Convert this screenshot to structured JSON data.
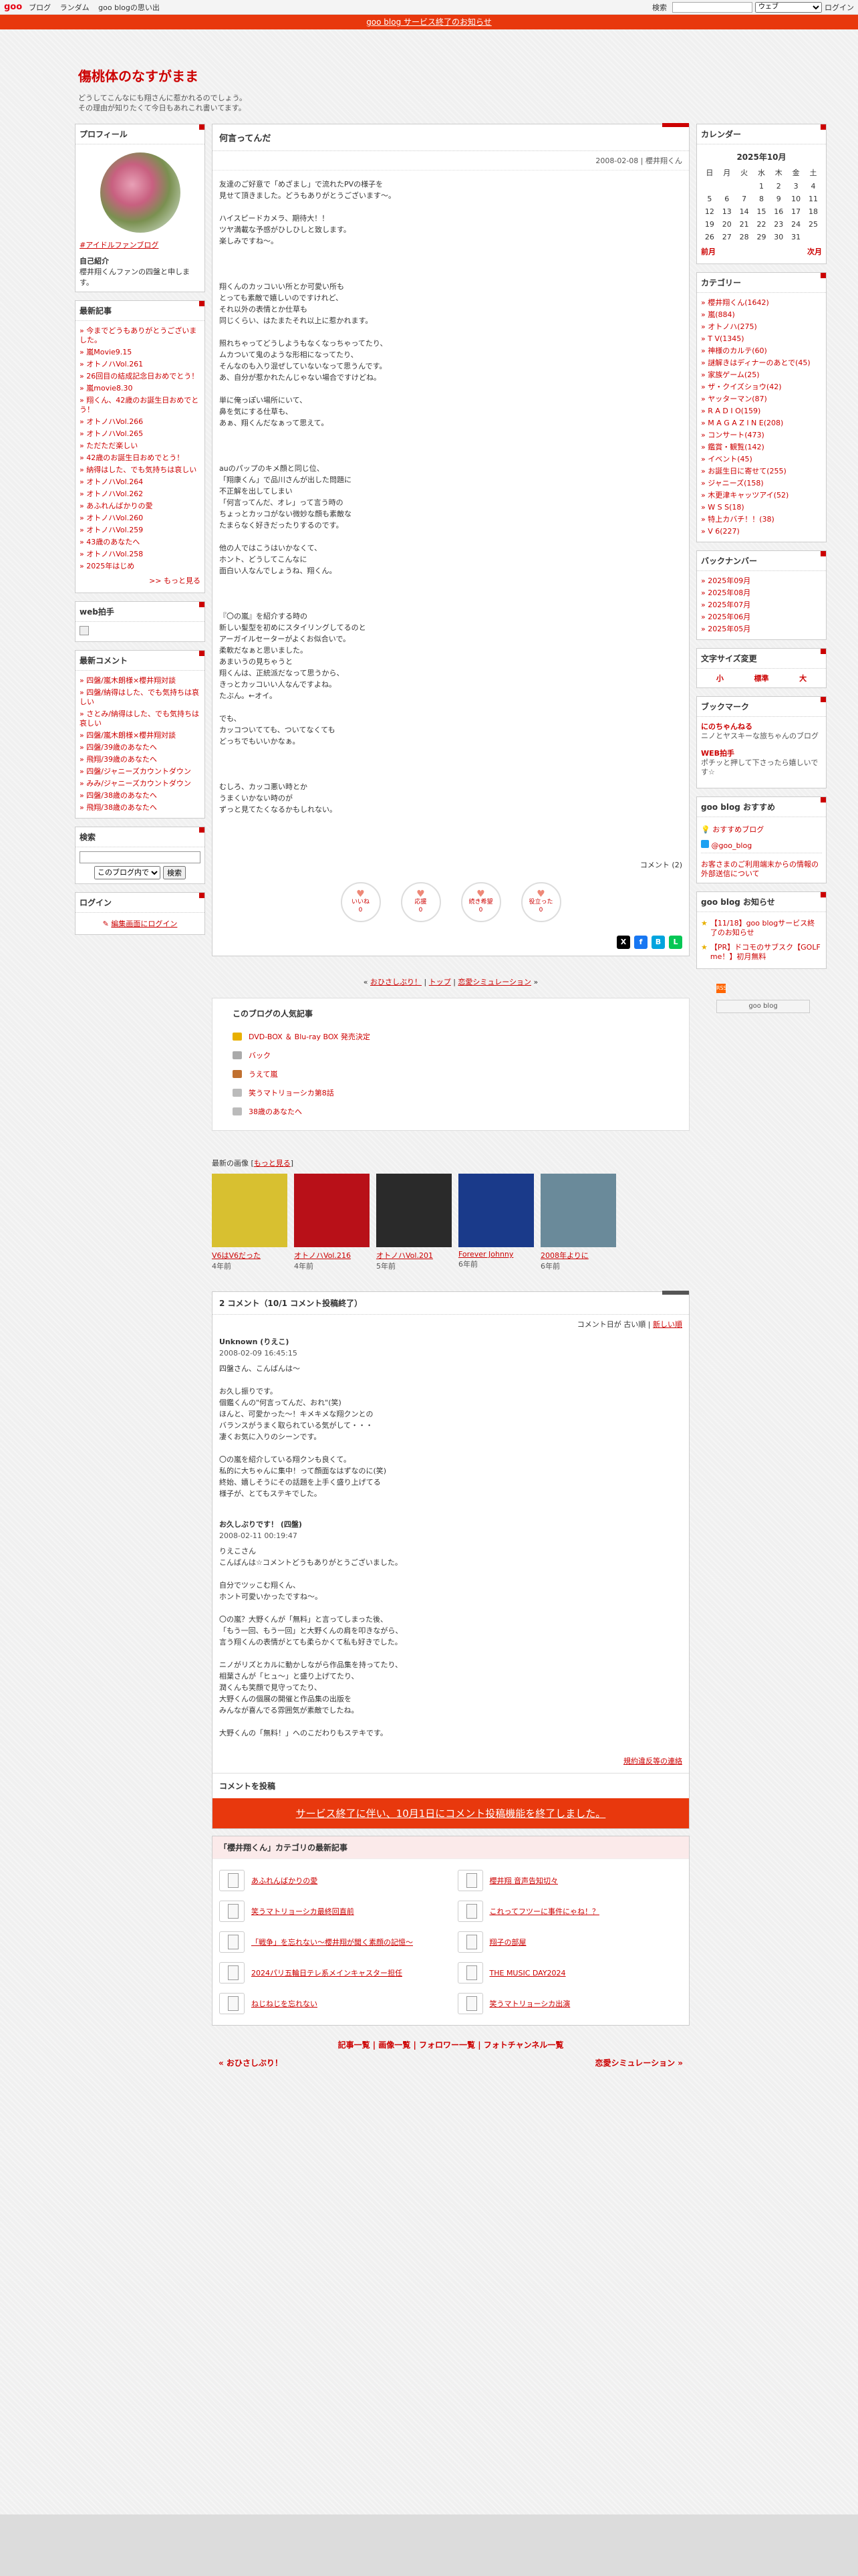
{
  "topbar": {
    "logo": "goo",
    "nav": [
      "ブログ",
      "ランダム",
      "goo blogの思い出"
    ],
    "search_label": "検索",
    "search_scope": "ウェブ",
    "login": "ログイン"
  },
  "notice": "goo blog サービス終了のお知らせ",
  "header": {
    "title": "傷桃体のなすがまま",
    "desc1": "どうしてこんなにも翔さんに惹かれるのでしょう。",
    "desc2": "その理由が知りたくて今日もあれこれ書いてます。"
  },
  "left": {
    "profile": {
      "heading": "プロフィール",
      "link": "#アイドルファンブログ",
      "intro_label": "自己紹介",
      "intro": "櫻井翔くんファンの四盤と申します。"
    },
    "recent": {
      "heading": "最新記事",
      "items": [
        "今までどうもありがとうございました。",
        "嵐Movie9.15",
        "オトノハVol.261",
        "26回目の結成記念日おめでとう！",
        "嵐movie8.30",
        "翔くん、42歳のお誕生日おめでとう！",
        "オトノハVol.266",
        "オトノハVol.265",
        "ただただ楽しい",
        "42歳のお誕生日おめでとう！",
        "納得はした、でも気持ちは哀しい",
        "オトノハVol.264",
        "オトノハVol.262",
        "あふれんばかりの愛",
        "オトノハVol.260",
        "オトノハVol.259",
        "43歳のあなたへ",
        "オトノハVol.258",
        "2025年はじめ"
      ],
      "more": ">> もっと見る"
    },
    "webclap": {
      "heading": "web拍手"
    },
    "comments": {
      "heading": "最新コメント",
      "items": [
        "四盤/嵐木朗様×櫻井翔対談",
        "四盤/納得はした、でも気持ちは哀しい",
        "さとみ/納得はした、でも気持ちは哀しい",
        "四盤/嵐木朗様×櫻井翔対談",
        "四盤/39歳のあなたへ",
        "飛翔/39歳のあなたへ",
        "四盤/ジャニーズカウントダウン",
        "みみ/ジャニーズカウントダウン",
        "四盤/38歳のあなたへ",
        "飛翔/38歳のあなたへ"
      ]
    },
    "search": {
      "heading": "検索",
      "scope": "このブログ内で",
      "button": "検索"
    },
    "login": {
      "heading": "ログイン",
      "link": "編集画面にログイン"
    }
  },
  "article": {
    "title": "何言ってんだ",
    "meta": "2008-02-08 | 櫻井翔くん",
    "paragraphs": [
      [
        "友達のご好意で「めざまし」で流れたPVの様子を",
        "見せて頂きました。どうもありがとうございます～。"
      ],
      [
        "ハイスピードカメラ、期待大！！",
        "ツヤ満載な予感がひしひしと致します。",
        "楽しみですね～。"
      ],
      [],
      [
        "翔くんのカッコいい所とか可愛い所も",
        "とっても素敵で嬉しいのですけれど、",
        "それ以外の表情とか仕草も",
        "同じくらい、はたまたそれ以上に惹かれます。"
      ],
      [
        "照れちゃってどうしようもなくなっちゃってたり、",
        "ムカついて鬼のような形相になってたり、",
        "そんなのも入り混ぜしていないなって思うんです。",
        "あ、自分が惹かれたんじゃない場合ですけどね。"
      ],
      [
        "単に俺っぽい場所にいて、",
        "鼻を気にする仕草も、",
        "あぁ、翔くんだなぁって思えて。"
      ],
      [],
      [
        "auのパップのキメ顔と同じ位、",
        "「翔康くん」で品川さんが出した問題に",
        "不正解を出してしまい",
        "「何言ってんだ、オレ」って言う時の",
        "ちょっとカッコがない微妙な顔も素敵な",
        "たまらなく好きだったりするのです。"
      ],
      [
        "他の人ではこうはいかなくて、",
        "ホント、どうしてこんなに",
        "面白い人なんでしょうね、翔くん。"
      ],
      [],
      [
        "『〇の嵐』を紹介する時の",
        "新しい髪型を初めにスタイリングしてるのと",
        "アーガイルセーターがよくお似合いで。",
        "柔軟だなぁと思いました。",
        "あまいうの見ちゃうと",
        "翔くんは、正統派だなって思うから、",
        "きっとカッコいい人なんですよね。",
        "たぶん。←オイ。"
      ],
      [
        "でも、",
        "カッコついてても、ついてなくても",
        "どっちでもいいかなぁ。"
      ],
      [],
      [
        "むしろ、カッコ悪い時とか",
        "うまくいかない時のが",
        "ずっと見てたくなるかもしれない。"
      ]
    ],
    "comment_count": "コメント (2)",
    "reactions": [
      {
        "label": "いいね",
        "count": "0"
      },
      {
        "label": "応援",
        "count": "0"
      },
      {
        "label": "続き希望",
        "count": "0"
      },
      {
        "label": "役立った",
        "count": "0"
      }
    ]
  },
  "pager": {
    "prev": "おひさしぶり！",
    "top": "トップ",
    "next": "恋愛シミュレーション"
  },
  "popular": {
    "heading": "このブログの人気記事",
    "items": [
      "DVD-BOX ＆ Blu-ray BOX 発売決定",
      "バック",
      "うえて嵐",
      "笑うマトリョーシカ第8話",
      "38歳のあなたへ"
    ]
  },
  "images": {
    "label": "最新の画像",
    "more": "もっと見る",
    "items": [
      {
        "title": "V6はV6だった",
        "age": "4年前",
        "color": "#d8c030"
      },
      {
        "title": "オトノハVol.216",
        "age": "4年前",
        "color": "#b81018"
      },
      {
        "title": "オトノハVol.201",
        "age": "5年前",
        "color": "#2a2a2a"
      },
      {
        "title": "Forever Johnny",
        "age": "6年前",
        "color": "#1a3a8a"
      },
      {
        "title": "2008年よりに",
        "age": "6年前",
        "color": "#6a8a9a"
      }
    ]
  },
  "comments": {
    "header": "2 コメント（10/1 コメント投稿終了）",
    "sort_label": "コメント日が",
    "sort_old": "古い順",
    "sort_new": "新しい順",
    "items": [
      {
        "who": "Unknown (りえこ)",
        "date": "2008-02-09 16:45:15",
        "paras": [
          [
            "四盤さん、こんばんは～"
          ],
          [
            "お久し振りです。",
            "個鑑くんの\"何言ってんだ、おれ\"(笑)",
            "ほんと、可愛かった～！キメキメな翔クンとの",
            "バランスがうまく取られている気がして・・・",
            "凄くお気に入りのシーンです。"
          ],
          [
            "〇の嵐を紹介している翔クンも良くて。",
            "私的に大ちゃんに集中！って顔面なはずなのに(笑)",
            "終始、嬉しそうにその話題を上手く盛り上げてる",
            "様子が、とてもステキでした。"
          ]
        ]
      },
      {
        "who": "お久しぶりです！ (四盤)",
        "date": "2008-02-11 00:19:47",
        "paras": [
          [
            "りえこさん",
            "こんばんは☆コメントどうもありがとうございました。"
          ],
          [
            "自分でツッこむ翔くん、",
            "ホント可愛いかったですね～。"
          ],
          [
            "〇の嵐？大野くんが「無料」と言ってしまった後、",
            "「もう一回、もう一回」と大野くんの肩を叩きながら、",
            "言う翔くんの表情がとても柔らかくて私も好きでした。"
          ],
          [
            "ニノがリズとカルに動かしながら作品集を持ってたり、",
            "相葉さんが「ヒュ～」と盛り上げてたり、",
            "潤くんも笑顔で見守ってたり、",
            "大野くんの個展の開催と作品集の出版を",
            "みんなが喜んでる雰囲気が素敵でしたね。"
          ],
          [
            "大野くんの「無料！」へのこだわりもステキです。"
          ]
        ]
      }
    ],
    "rules": "規約違反等の連絡"
  },
  "post": {
    "heading": "コメントを投稿",
    "closed": "サービス終了に伴い、10月1日にコメント投稿機能を終了しました。"
  },
  "cat_latest": {
    "heading": "「櫻井翔くん」カテゴリの最新記事",
    "items": [
      "あふれんばかりの愛",
      "櫻井翔 音声告知切々",
      "笑うマトリョーシカ最終回直前",
      "これってフツーに事件にゃね！？",
      "「戦争」を忘れない～櫻井翔が聞く素顔の記憶～",
      "翔子の部屋",
      "2024パリ五輪日テレ系メインキャスター担任",
      "THE MUSIC DAY2024",
      "ねじねじを忘れない",
      "笑うマトリョーシカ出演"
    ]
  },
  "footer": {
    "links": "記事一覧 | 画像一覧 | フォロワー一覧 | フォトチャンネル一覧",
    "prev": "« おひさしぶり！",
    "next": "恋愛シミュレーション »"
  },
  "right": {
    "calendar": {
      "heading": "カレンダー",
      "month": "2025年10月",
      "weekdays": [
        "日",
        "月",
        "火",
        "水",
        "木",
        "金",
        "土"
      ],
      "rows": [
        [
          "",
          "",
          "",
          "1",
          "2",
          "3",
          "4"
        ],
        [
          "5",
          "6",
          "7",
          "8",
          "9",
          "10",
          "11"
        ],
        [
          "12",
          "13",
          "14",
          "15",
          "16",
          "17",
          "18"
        ],
        [
          "19",
          "20",
          "21",
          "22",
          "23",
          "24",
          "25"
        ],
        [
          "26",
          "27",
          "28",
          "29",
          "30",
          "31",
          ""
        ]
      ],
      "prev": "前月",
      "next": "次月"
    },
    "categories": {
      "heading": "カテゴリー",
      "items": [
        "櫻井翔くん(1642)",
        "嵐(884)",
        "オトノハ(275)",
        "T V(1345)",
        "神様のカルテ(60)",
        "謎解きはディナーのあとで(45)",
        "家族ゲーム(25)",
        "ザ・クイズショウ(42)",
        "ヤッターマン(87)",
        "R A D I O(159)",
        "M A G A Z I N E(208)",
        "コンサート(473)",
        "鑑賞・観覧(142)",
        "イベント(45)",
        "お誕生日に寄せて(255)",
        "ジャニーズ(158)",
        "木更津キャッツアイ(52)",
        "W S S(18)",
        "特上カバチ！！(38)",
        "V 6(227)"
      ]
    },
    "backnumber": {
      "heading": "バックナンバー",
      "items": [
        "2025年09月",
        "2025年08月",
        "2025年07月",
        "2025年06月",
        "2025年05月"
      ]
    },
    "fontsize": {
      "heading": "文字サイズ変更",
      "small": "小",
      "normal": "標準",
      "large": "大"
    },
    "bookmarks": {
      "heading": "ブックマーク",
      "items": [
        {
          "title": "にのちゃんねる",
          "desc": "ニノとヤスキーな旅ちゃんのブログ"
        },
        {
          "title": "WEB拍手",
          "desc": "ポチッと押して下さったら嬉しいです☆"
        }
      ]
    },
    "recommend": {
      "heading": "goo blog おすすめ",
      "items": [
        "おすすめブログ",
        "@goo_blog"
      ],
      "note": "お客さまのご利用端末からの情報の外部送信について"
    },
    "news": {
      "heading": "goo blog お知らせ",
      "items": [
        "【11/18】goo blogサービス終了のお知らせ",
        "【PR】ドコモのサブスク【GOLF me！】初月無料"
      ]
    },
    "rss": "RSS",
    "badge": "goo blog"
  }
}
